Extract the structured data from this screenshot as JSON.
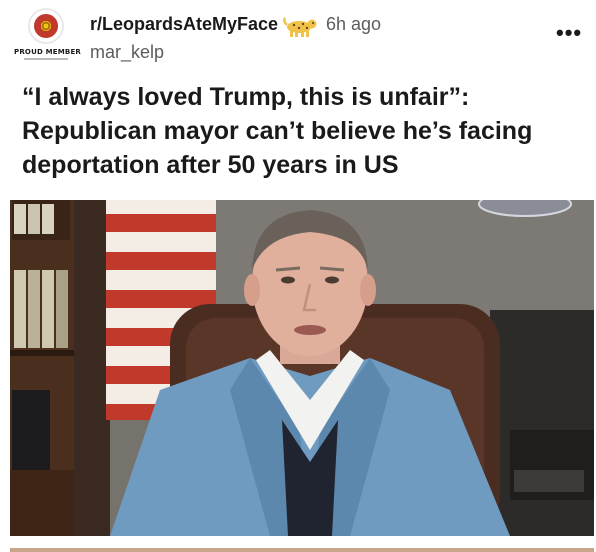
{
  "post": {
    "subreddit": "r/LeopardsAteMyFace",
    "time": "6h ago",
    "username": "mar_kelp",
    "flair": "PROUD MEMBER",
    "more_label": "•••",
    "title": "“I always loved Trump, this is unfair”: Republican mayor can’t believe he’s facing deportation after 50 years in US"
  },
  "icons": {
    "avatar": "subreddit-avatar",
    "leopard": "leopard-icon",
    "more": "more-options-icon"
  },
  "colors": {
    "text": "#1a1a1b",
    "meta": "#5c5c5c",
    "blazer": "#6f9bc0",
    "flag_red": "#c0392b"
  }
}
